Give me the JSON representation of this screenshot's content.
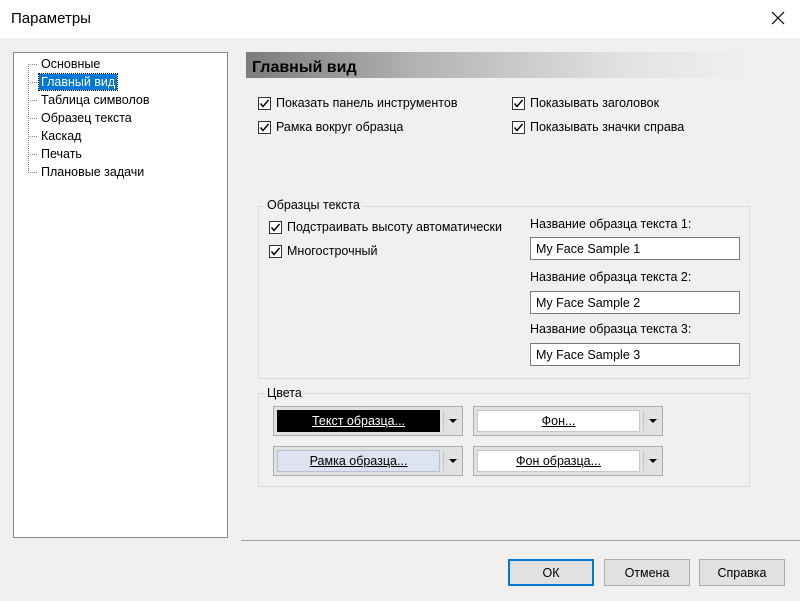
{
  "window": {
    "title": "Параметры"
  },
  "tree": {
    "items": [
      {
        "label": "Основные"
      },
      {
        "label": "Главный вид",
        "selected": true
      },
      {
        "label": "Таблица символов"
      },
      {
        "label": "Образец текста"
      },
      {
        "label": "Каскад"
      },
      {
        "label": "Печать"
      },
      {
        "label": "Плановые задачи"
      }
    ]
  },
  "page": {
    "header": "Главный вид",
    "checks": {
      "show_toolbar": {
        "label": "Показать панель инструментов",
        "checked": true
      },
      "show_title": {
        "label": "Показывать заголовок",
        "checked": true
      },
      "sample_border": {
        "label": "Рамка вокруг образца",
        "checked": true
      },
      "show_icons_right": {
        "label": "Показывать значки справа",
        "checked": true
      }
    },
    "samples_group": {
      "title": "Образцы текста",
      "auto_height": {
        "label": "Подстраивать высоту автоматически",
        "checked": true
      },
      "multiline": {
        "label": "Многострочный",
        "checked": true
      },
      "names": [
        {
          "label": "Название образца текста 1:",
          "value": "My Face Sample 1"
        },
        {
          "label": "Название образца текста 2:",
          "value": "My Face Sample 2"
        },
        {
          "label": "Название образца текста 3:",
          "value": "My Face Sample 3"
        }
      ]
    },
    "colors_group": {
      "title": "Цвета",
      "sample_text": {
        "label": "Текст образца...",
        "bg": "#000000",
        "fg": "#ffffff"
      },
      "background": {
        "label": "Фон...",
        "bg": "#ffffff",
        "fg": "#000000"
      },
      "sample_border": {
        "label": "Рамка образца...",
        "bg": "#dde3f0",
        "fg": "#000000"
      },
      "sample_background": {
        "label": "Фон образца...",
        "bg": "#ffffff",
        "fg": "#000000"
      }
    }
  },
  "buttons": {
    "ok": "ОК",
    "cancel": "Отмена",
    "help": "Справка"
  },
  "colors": {
    "selection": "#0078d7",
    "window_bg": "#f0f0f0"
  }
}
